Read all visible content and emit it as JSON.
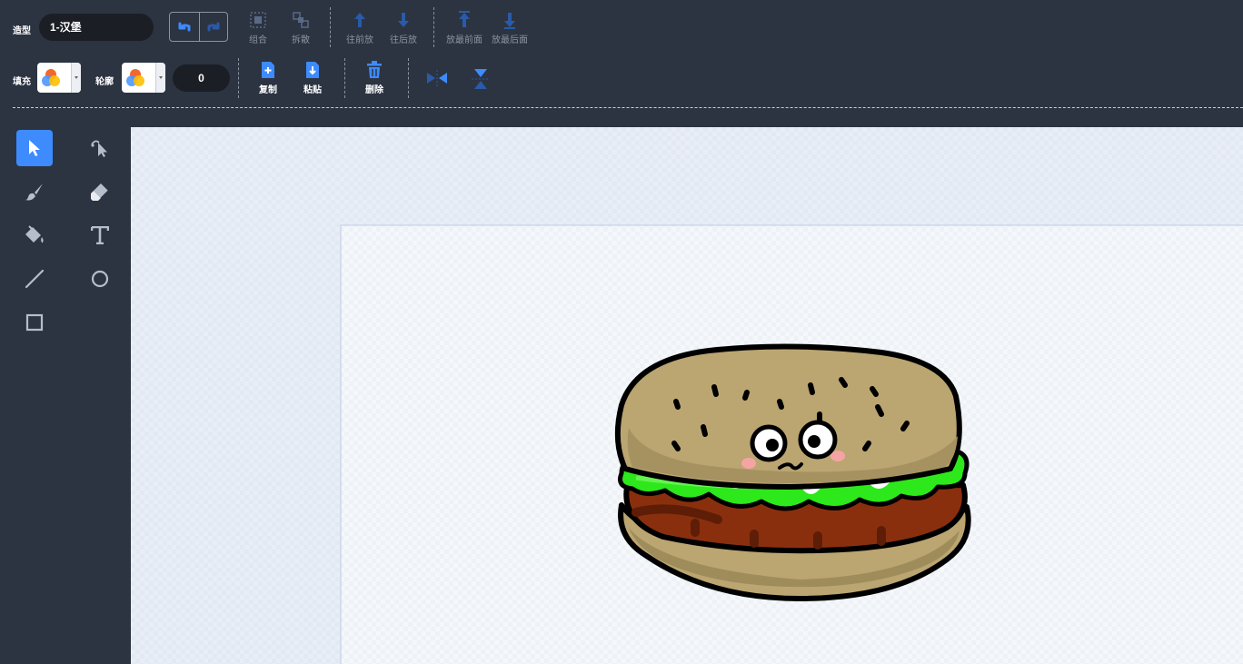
{
  "toolbar": {
    "costume_label": "造型",
    "costume_name": "1-汉堡",
    "group_label": "组合",
    "ungroup_label": "拆散",
    "forward_label": "往前放",
    "backward_label": "往后放",
    "front_label": "放最前面",
    "back_label": "放最后面",
    "fill_label": "填充",
    "outline_label": "轮廓",
    "outline_width": "0",
    "copy_label": "复制",
    "paste_label": "粘贴",
    "delete_label": "删除"
  },
  "tools": [
    {
      "name": "select",
      "icon": "select-arrow-icon",
      "active": true
    },
    {
      "name": "reshape",
      "icon": "reshape-icon",
      "active": false
    },
    {
      "name": "brush",
      "icon": "brush-icon",
      "active": false
    },
    {
      "name": "eraser",
      "icon": "eraser-icon",
      "active": false
    },
    {
      "name": "fill",
      "icon": "paint-bucket-icon",
      "active": false
    },
    {
      "name": "text",
      "icon": "text-icon",
      "active": false
    },
    {
      "name": "line",
      "icon": "line-icon",
      "active": false
    },
    {
      "name": "circle",
      "icon": "circle-icon",
      "active": false
    },
    {
      "name": "rectangle",
      "icon": "rectangle-icon",
      "active": false
    }
  ],
  "colors": {
    "toolbar_bg": "#2c3442",
    "accent": "#3d8bfd",
    "canvas_bg": "#e9eef6"
  }
}
